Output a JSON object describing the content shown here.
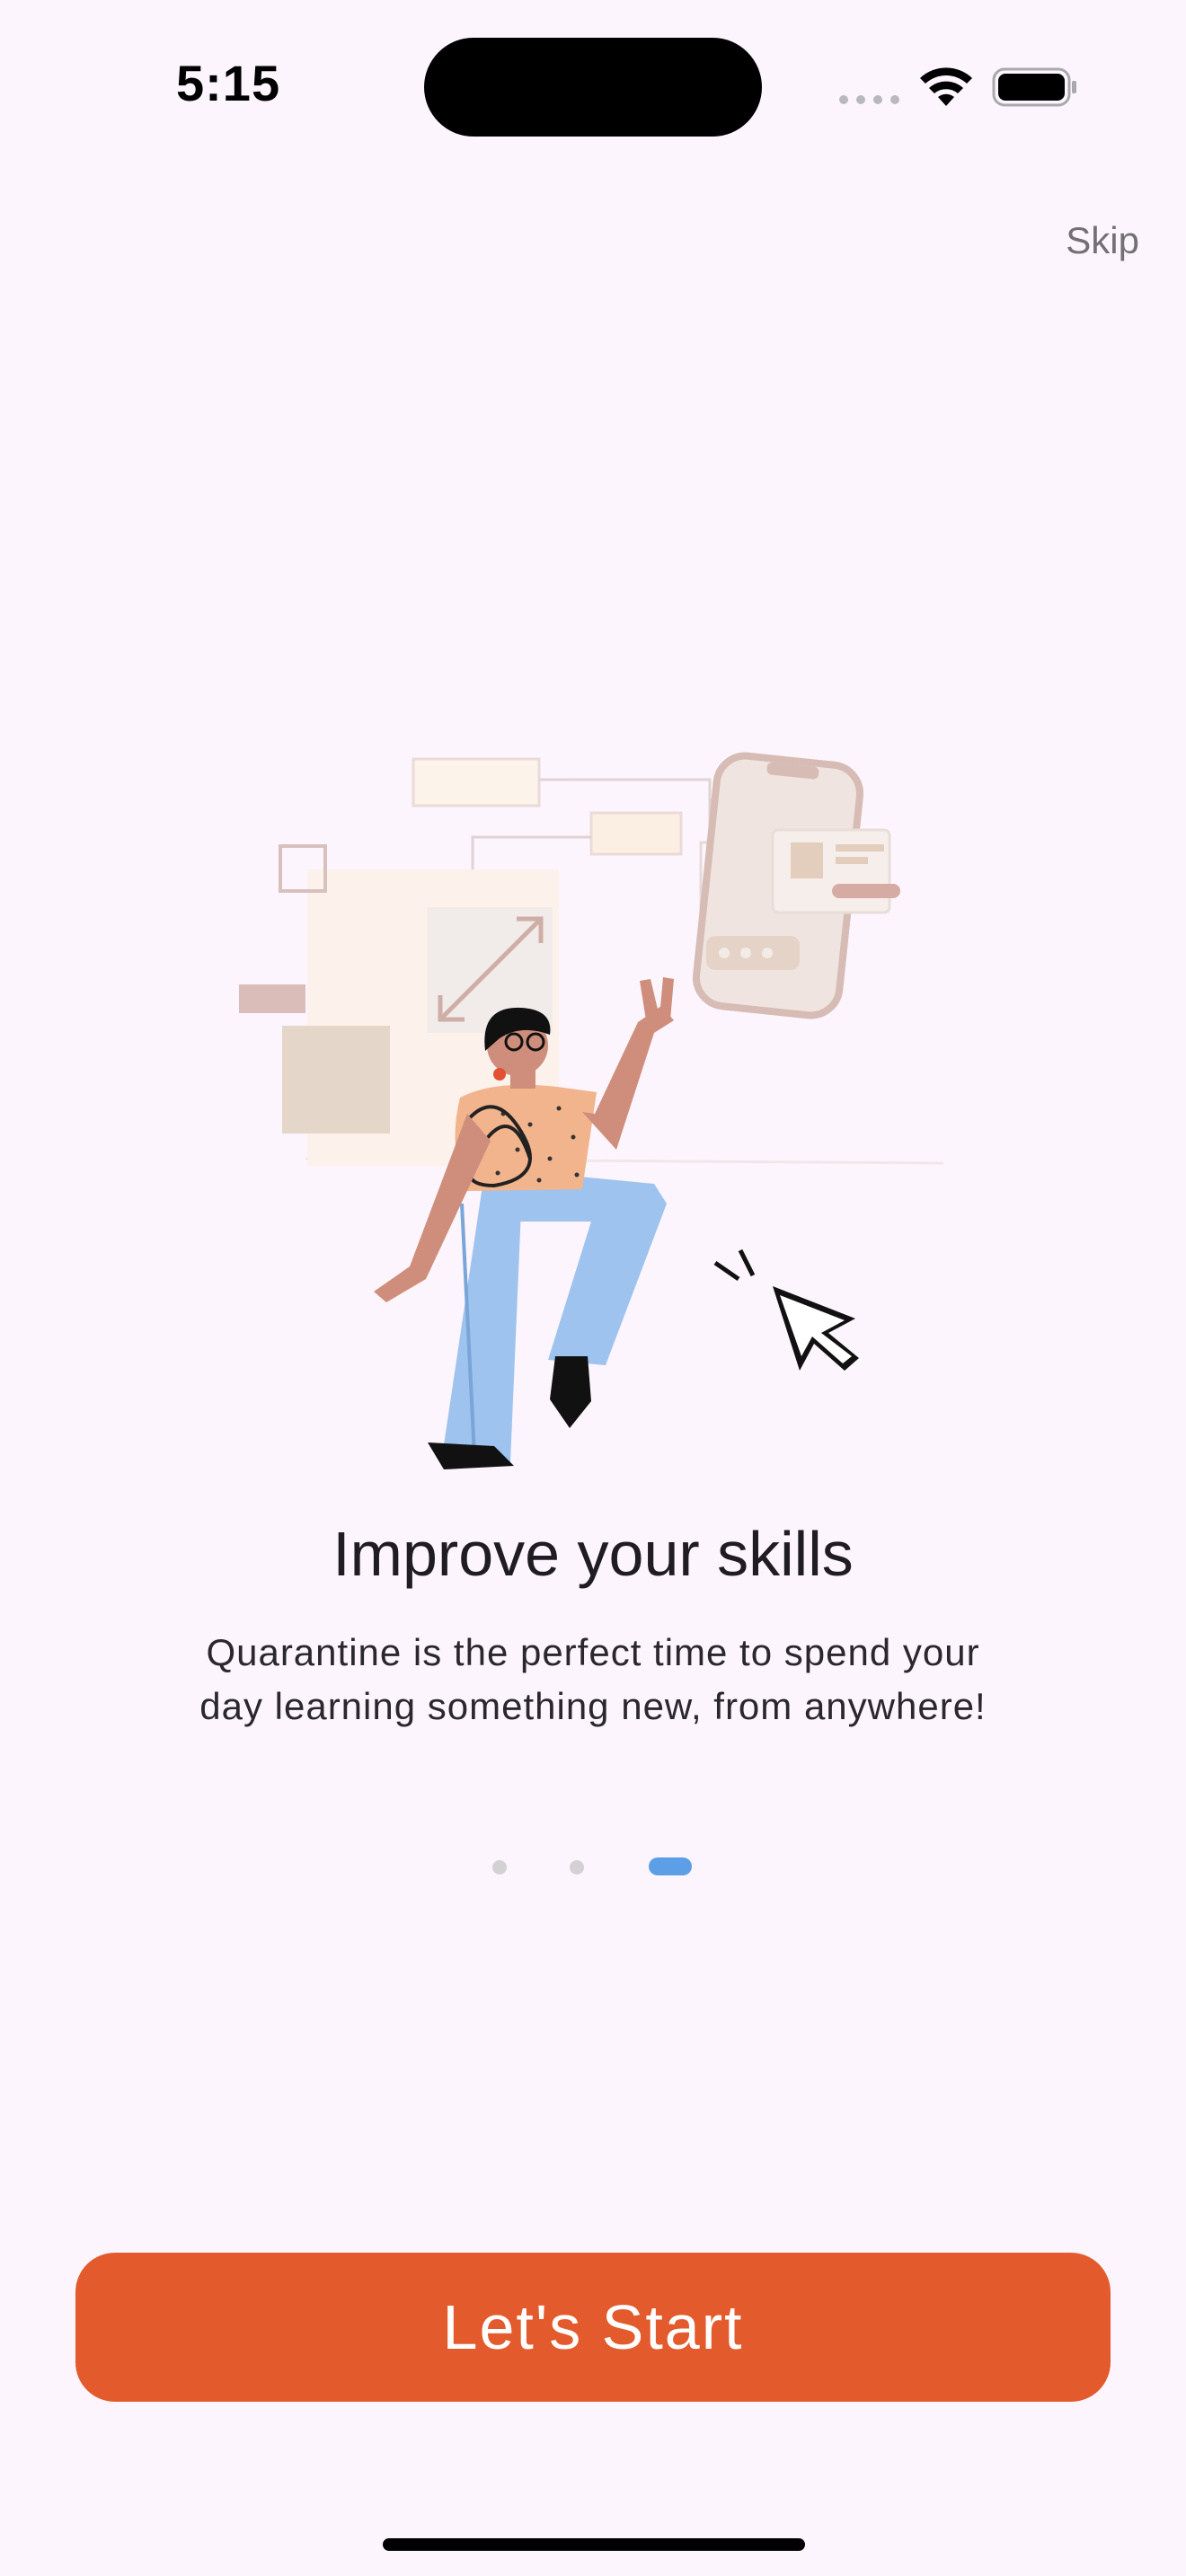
{
  "status_bar": {
    "time": "5:15"
  },
  "header": {
    "skip_label": "Skip"
  },
  "onboarding": {
    "title": "Improve your skills",
    "description_line1": "Quarantine is the perfect time to spend your",
    "description_line2": "day learning something new, from anywhere!",
    "illustration_icon": "person-learning-illustration",
    "page_indicator": {
      "total": 3,
      "current": 3
    }
  },
  "footer": {
    "cta_label": "Let's Start"
  },
  "colors": {
    "background": "#FCF5FD",
    "accent": "#E35A2D",
    "indicator_active": "#5C9FE6",
    "indicator_inactive": "#D3D1D4"
  }
}
